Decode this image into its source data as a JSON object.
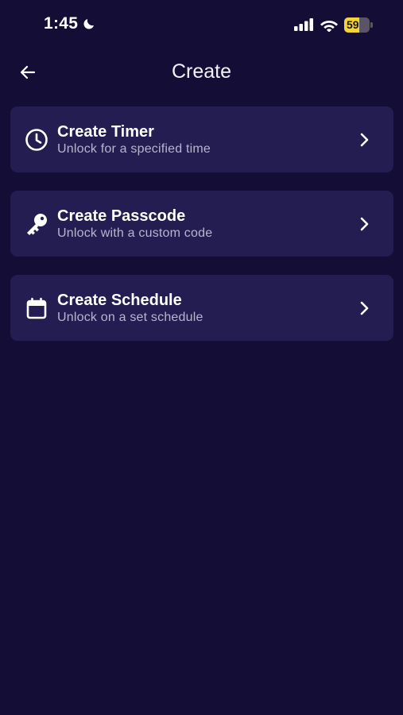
{
  "status_bar": {
    "time": "1:45",
    "battery_level": "59",
    "battery_fraction": 0.59,
    "battery_color": "#f4d43a"
  },
  "header": {
    "title": "Create",
    "back_icon": "arrow-left-icon"
  },
  "items": [
    {
      "title": "Create Timer",
      "subtitle": "Unlock for a specified time",
      "icon": "clock-icon"
    },
    {
      "title": "Create Passcode",
      "subtitle": "Unlock with a custom code",
      "icon": "key-icon"
    },
    {
      "title": "Create Schedule",
      "subtitle": "Unlock on a set schedule",
      "icon": "calendar-icon"
    }
  ],
  "colors": {
    "background": "#140e37",
    "card": "#231d51",
    "subtitle": "#b9b5cf"
  }
}
